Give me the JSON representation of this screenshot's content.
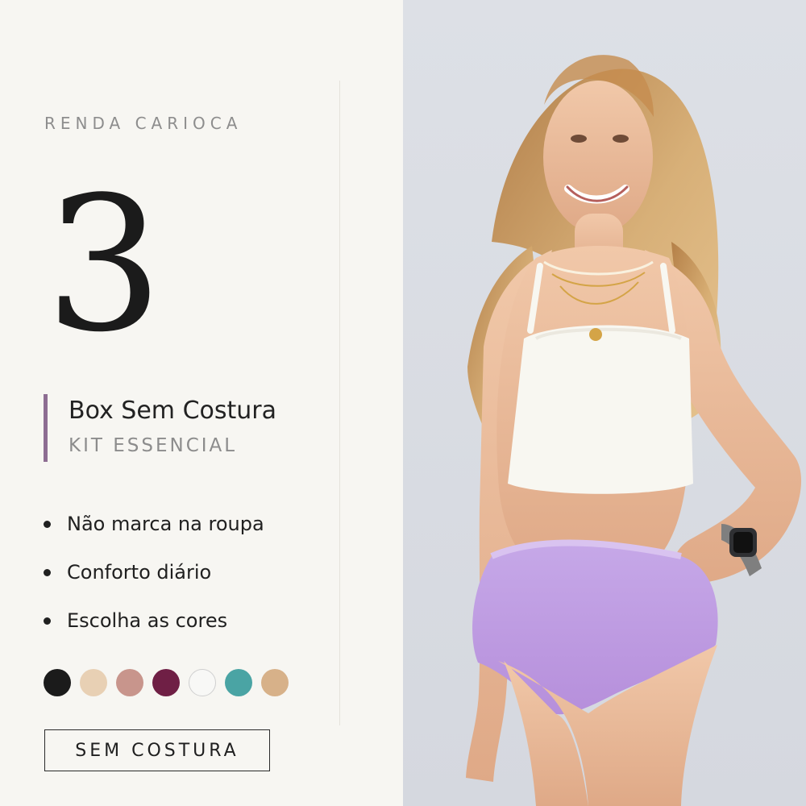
{
  "brand": "RENDA CARIOCA",
  "count": "3",
  "product": {
    "title": "Box Sem Costura",
    "subtitle": "KIT ESSENCIAL"
  },
  "features": [
    "Não marca na roupa",
    "Conforto diário",
    "Escolha as cores"
  ],
  "colors": [
    "#1b1b1b",
    "#e8d0b4",
    "#c8958c",
    "#6f1f45",
    "#f8f8f6",
    "#4aa4a4",
    "#d7b189"
  ],
  "tag": "SEM COSTURA",
  "accent_color": "#8d6d92",
  "image": {
    "subject_icon": "model-photo"
  }
}
